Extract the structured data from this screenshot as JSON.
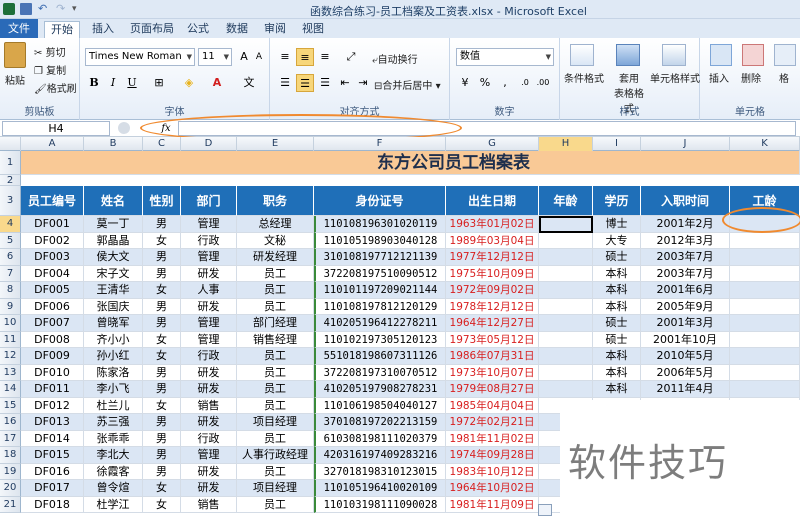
{
  "window": {
    "title": "函数综合练习-员工档案及工资表.xlsx - Microsoft Excel"
  },
  "tabs": [
    "文件",
    "开始",
    "插入",
    "页面布局",
    "公式",
    "数据",
    "审阅",
    "视图"
  ],
  "ribbon": {
    "clipboard": {
      "paste": "粘贴",
      "cut": "剪切",
      "copy": "复制",
      "format_painter": "格式刷",
      "label": "剪贴板"
    },
    "font": {
      "name": "Times New Roman",
      "size": "11",
      "label": "字体",
      "wen": "文"
    },
    "alignment": {
      "wrap": "自动换行",
      "merge": "合并后居中",
      "label": "对齐方式"
    },
    "number": {
      "format": "数值",
      "label": "数字"
    },
    "styles": {
      "conditional": "条件格式",
      "table_fmt": "套用\n表格格式",
      "cell_styles": "单元格样式",
      "label": "样式"
    },
    "cells": {
      "insert": "插入",
      "delete": "删除",
      "format": "格",
      "label": "单元格"
    }
  },
  "formula_bar": {
    "name_box": "H4",
    "fx": "fx",
    "formula": ""
  },
  "columns": [
    "A",
    "B",
    "C",
    "D",
    "E",
    "F",
    "G",
    "H",
    "I",
    "J",
    "K"
  ],
  "selected_cell": "H4",
  "sheet": {
    "title": "东方公司员工档案表",
    "headers": [
      "员工编号",
      "姓名",
      "性别",
      "部门",
      "职务",
      "身份证号",
      "出生日期",
      "年龄",
      "学历",
      "入职时间",
      "工龄"
    ],
    "rows": [
      {
        "n": "4",
        "cells": [
          "DF001",
          "莫一丁",
          "男",
          "管理",
          "总经理",
          "110108196301020119",
          "1963年01月02日",
          "",
          "博士",
          "2001年2月",
          ""
        ]
      },
      {
        "n": "5",
        "cells": [
          "DF002",
          "郭晶晶",
          "女",
          "行政",
          "文秘",
          "110105198903040128",
          "1989年03月04日",
          "",
          "大专",
          "2012年3月",
          ""
        ]
      },
      {
        "n": "6",
        "cells": [
          "DF003",
          "侯大文",
          "男",
          "管理",
          "研发经理",
          "310108197712121139",
          "1977年12月12日",
          "",
          "硕士",
          "2003年7月",
          ""
        ]
      },
      {
        "n": "7",
        "cells": [
          "DF004",
          "宋子文",
          "男",
          "研发",
          "员工",
          "372208197510090512",
          "1975年10月09日",
          "",
          "本科",
          "2003年7月",
          ""
        ]
      },
      {
        "n": "8",
        "cells": [
          "DF005",
          "王清华",
          "女",
          "人事",
          "员工",
          "110101197209021144",
          "1972年09月02日",
          "",
          "本科",
          "2001年6月",
          ""
        ]
      },
      {
        "n": "9",
        "cells": [
          "DF006",
          "张国庆",
          "男",
          "研发",
          "员工",
          "110108197812120129",
          "1978年12月12日",
          "",
          "本科",
          "2005年9月",
          ""
        ]
      },
      {
        "n": "10",
        "cells": [
          "DF007",
          "曾晓军",
          "男",
          "管理",
          "部门经理",
          "410205196412278211",
          "1964年12月27日",
          "",
          "硕士",
          "2001年3月",
          ""
        ]
      },
      {
        "n": "11",
        "cells": [
          "DF008",
          "齐小小",
          "女",
          "管理",
          "销售经理",
          "110102197305120123",
          "1973年05月12日",
          "",
          "硕士",
          "2001年10月",
          ""
        ]
      },
      {
        "n": "12",
        "cells": [
          "DF009",
          "孙小红",
          "女",
          "行政",
          "员工",
          "551018198607311126",
          "1986年07月31日",
          "",
          "本科",
          "2010年5月",
          ""
        ]
      },
      {
        "n": "13",
        "cells": [
          "DF010",
          "陈家洛",
          "男",
          "研发",
          "员工",
          "372208197310070512",
          "1973年10月07日",
          "",
          "本科",
          "2006年5月",
          ""
        ]
      },
      {
        "n": "14",
        "cells": [
          "DF011",
          "李小飞",
          "男",
          "研发",
          "员工",
          "410205197908278231",
          "1979年08月27日",
          "",
          "本科",
          "2011年4月",
          ""
        ]
      },
      {
        "n": "15",
        "cells": [
          "DF012",
          "杜兰儿",
          "女",
          "销售",
          "员工",
          "110106198504040127",
          "1985年04月04日",
          "",
          "",
          "",
          ""
        ]
      },
      {
        "n": "16",
        "cells": [
          "DF013",
          "苏三强",
          "男",
          "研发",
          "项目经理",
          "370108197202213159",
          "1972年02月21日",
          "",
          "",
          "",
          ""
        ]
      },
      {
        "n": "17",
        "cells": [
          "DF014",
          "张乖乖",
          "男",
          "行政",
          "员工",
          "610308198111020379",
          "1981年11月02日",
          "",
          "",
          "",
          ""
        ]
      },
      {
        "n": "18",
        "cells": [
          "DF015",
          "李北大",
          "男",
          "管理",
          "人事行政经理",
          "420316197409283216",
          "1974年09月28日",
          "",
          "",
          "",
          ""
        ]
      },
      {
        "n": "19",
        "cells": [
          "DF016",
          "徐霞客",
          "男",
          "研发",
          "员工",
          "327018198310123015",
          "1983年10月12日",
          "",
          "",
          "",
          ""
        ]
      },
      {
        "n": "20",
        "cells": [
          "DF017",
          "曾令煊",
          "女",
          "研发",
          "项目经理",
          "110105196410020109",
          "1964年10月02日",
          "",
          "",
          "",
          ""
        ]
      },
      {
        "n": "21",
        "cells": [
          "DF018",
          "杜学江",
          "女",
          "销售",
          "员工",
          "110103198111090028",
          "1981年11月09日",
          "",
          "",
          "",
          ""
        ]
      }
    ]
  },
  "watermark": "软件技巧",
  "colors": {
    "header_blue": "#1f6fb8",
    "title_fill": "#f9c996",
    "date_red": "#d81e1e",
    "annot_orange": "#f08a2f",
    "excel_green": "#1d6f3a"
  }
}
